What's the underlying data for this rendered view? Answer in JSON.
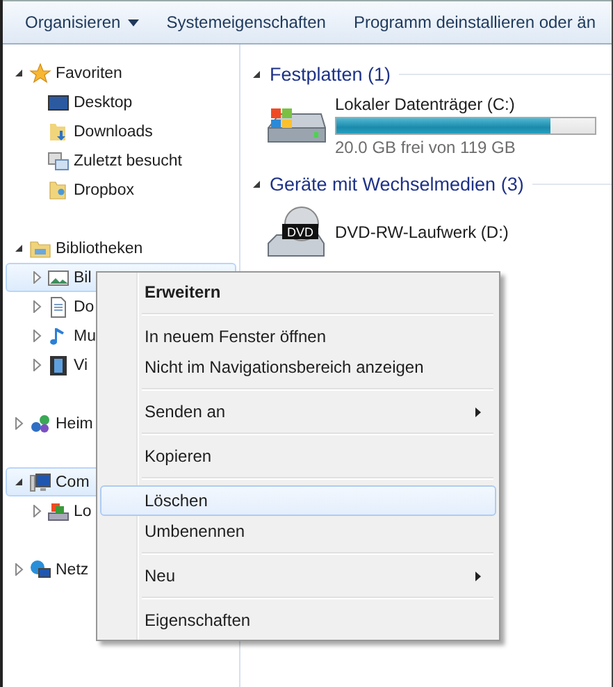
{
  "toolbar": {
    "buttons": [
      {
        "label": "Organisieren",
        "dropdown": true
      },
      {
        "label": "Systemeigenschaften",
        "dropdown": false
      },
      {
        "label": "Programm deinstallieren oder än",
        "dropdown": false
      }
    ]
  },
  "navigation": {
    "items": [
      {
        "label": "Favoriten",
        "kind": "star",
        "expanded": true,
        "selected": false,
        "children": [
          {
            "label": "Desktop",
            "kind": "desktop",
            "selected": false
          },
          {
            "label": "Downloads",
            "kind": "download",
            "selected": false
          },
          {
            "label": "Zuletzt besucht",
            "kind": "recent",
            "selected": false
          },
          {
            "label": "Dropbox",
            "kind": "folder",
            "selected": false
          }
        ]
      },
      {
        "label": "Bibliotheken",
        "kind": "library",
        "expanded": true,
        "selected": false,
        "children": [
          {
            "label": "Bil",
            "kind": "picture",
            "expanded": false,
            "selected": true
          },
          {
            "label": "Do",
            "kind": "document",
            "expanded": false,
            "selected": false
          },
          {
            "label": "Mu",
            "kind": "music",
            "expanded": false,
            "selected": false
          },
          {
            "label": "Vi",
            "kind": "video",
            "expanded": false,
            "selected": false
          }
        ]
      },
      {
        "label": "Heim",
        "kind": "homegroup",
        "expanded": false,
        "selected": false
      },
      {
        "label": "Com",
        "kind": "computer",
        "expanded": true,
        "selected": true,
        "children": [
          {
            "label": "Lo",
            "kind": "drive",
            "expanded": false,
            "selected": false
          }
        ]
      },
      {
        "label": "Netz",
        "kind": "network",
        "expanded": false,
        "selected": false
      }
    ]
  },
  "groups": [
    {
      "title": "Festplatten (1)",
      "expanded": true,
      "devices": [
        {
          "name": "Lokaler Datenträger (C:)",
          "kind": "harddisk",
          "level": 0.83,
          "space": "20.0 GB frei von 119 GB"
        }
      ]
    },
    {
      "title": "Geräte mit Wechselmedien (3)",
      "expanded": true,
      "devices": [
        {
          "name": "DVD-RW-Laufwerk (D:)",
          "kind": "dvd",
          "badge": "DVD"
        }
      ]
    }
  ],
  "context_menu": {
    "items": [
      {
        "kind": "item",
        "label": "Erweitern",
        "default": true,
        "submenu": false,
        "selected": false
      },
      {
        "kind": "separator"
      },
      {
        "kind": "item",
        "label": "In neuem Fenster öffnen",
        "default": false,
        "submenu": false,
        "selected": false
      },
      {
        "kind": "item",
        "label": "Nicht im Navigationsbereich anzeigen",
        "default": false,
        "submenu": false,
        "selected": false
      },
      {
        "kind": "separator"
      },
      {
        "kind": "item",
        "label": "Senden an",
        "default": false,
        "submenu": true,
        "selected": false
      },
      {
        "kind": "separator"
      },
      {
        "kind": "item",
        "label": "Kopieren",
        "default": false,
        "submenu": false,
        "selected": false
      },
      {
        "kind": "separator"
      },
      {
        "kind": "item",
        "label": "Löschen",
        "default": false,
        "submenu": false,
        "selected": true
      },
      {
        "kind": "item",
        "label": "Umbenennen",
        "default": false,
        "submenu": false,
        "selected": false
      },
      {
        "kind": "separator"
      },
      {
        "kind": "item",
        "label": "Neu",
        "default": false,
        "submenu": true,
        "selected": false
      },
      {
        "kind": "separator"
      },
      {
        "kind": "item",
        "label": "Eigenschaften",
        "default": false,
        "submenu": false,
        "selected": false
      }
    ]
  }
}
